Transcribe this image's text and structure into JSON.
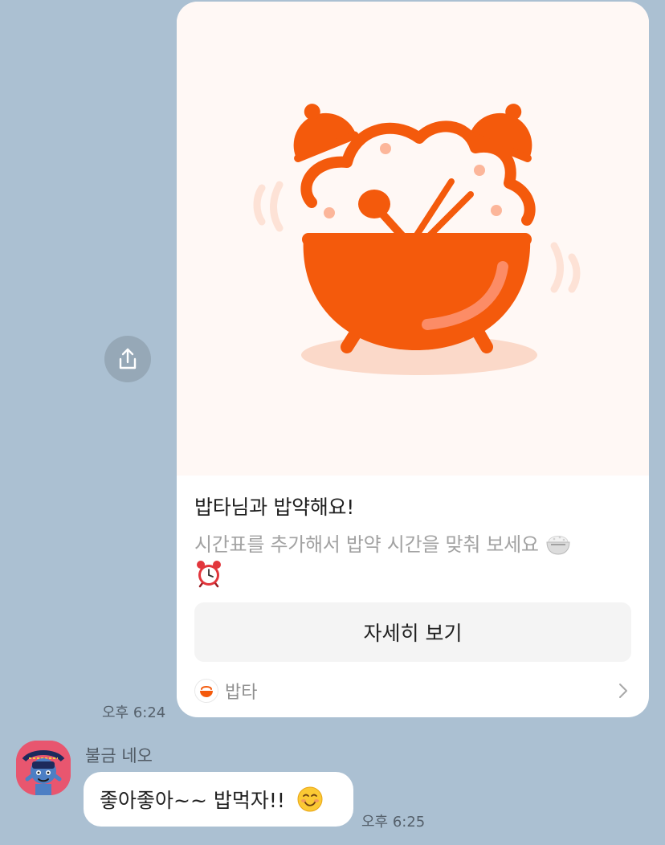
{
  "share": {
    "icon": "share-icon"
  },
  "card": {
    "illustration": "bowl-alarm-clock-illustration",
    "title": "밥타님과 밥약해요!",
    "description": "시간표를 추가해서 밥약 시간을 맞춰 보세요",
    "description_emojis": [
      "rice-emoji",
      "alarm-clock-emoji"
    ],
    "button_label": "자세히 보기",
    "footer": {
      "app_name": "밥타",
      "icon": "babta-logo-icon"
    },
    "timestamp": "오후 6:24"
  },
  "reply": {
    "sender": "불금 네오",
    "message": "좋아좋아~~ 밥먹자!!",
    "emoji": "smiling-face-emoji",
    "timestamp": "오후 6:25"
  },
  "colors": {
    "background": "#abc0d2",
    "accent": "#f45a0c",
    "card": "#ffffff",
    "illustration_bg": "#fff8f5"
  }
}
